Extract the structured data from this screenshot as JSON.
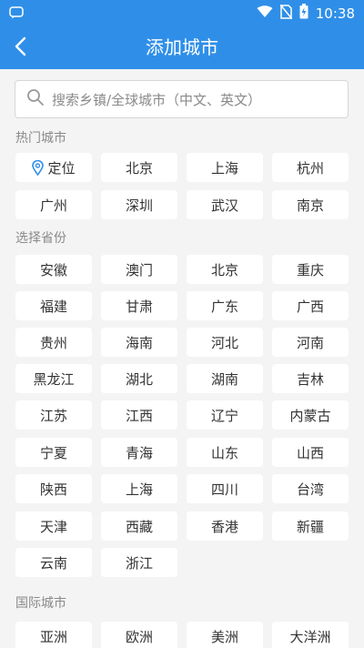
{
  "statusbar": {
    "time": "10:38"
  },
  "header": {
    "title": "添加城市"
  },
  "search": {
    "placeholder": "搜索乡镇/全球城市（中文、英文）"
  },
  "hot_cities": {
    "title": "热门城市",
    "locate_label": "定位",
    "items": [
      "北京",
      "上海",
      "杭州",
      "广州",
      "深圳",
      "武汉",
      "南京"
    ]
  },
  "provinces": {
    "title": "选择省份",
    "items": [
      "安徽",
      "澳门",
      "北京",
      "重庆",
      "福建",
      "甘肃",
      "广东",
      "广西",
      "贵州",
      "海南",
      "河北",
      "河南",
      "黑龙江",
      "湖北",
      "湖南",
      "吉林",
      "江苏",
      "江西",
      "辽宁",
      "内蒙古",
      "宁夏",
      "青海",
      "山东",
      "山西",
      "陕西",
      "上海",
      "四川",
      "台湾",
      "天津",
      "西藏",
      "香港",
      "新疆",
      "云南",
      "浙江"
    ]
  },
  "international": {
    "title": "国际城市",
    "items": [
      "亚洲",
      "欧洲",
      "美洲",
      "大洋洲"
    ]
  },
  "colors": {
    "accent": "#2f8fe8",
    "background": "#f4f4f4"
  }
}
